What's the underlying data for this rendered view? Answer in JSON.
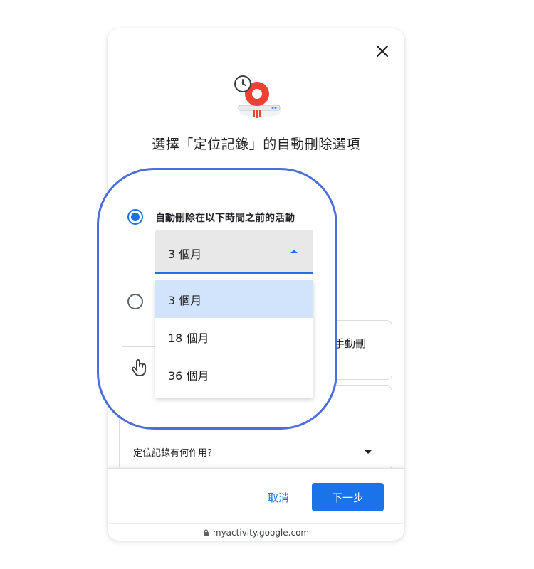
{
  "dialog": {
    "title": "選擇「定位記錄」的自動刪除選項",
    "close_icon": "close-icon",
    "illustration_icon": "location-history-clock-icon"
  },
  "options": {
    "auto_delete_label": "自動刪除在以下時間之前的活動",
    "selected_value": "3 個月",
    "menu_items": [
      "3 個月",
      "18 個月",
      "36 個月"
    ],
    "behind_text": "手動刪",
    "faq_label": "定位記錄有何作用？"
  },
  "footer": {
    "cancel_label": "取消",
    "next_label": "下一步"
  },
  "url_bar": {
    "url": "myactivity.google.com"
  },
  "colors": {
    "accent": "#1a73e8",
    "lens_border": "#4a6ee0",
    "menu_highlight": "#d2e3fc",
    "select_bg": "#e8e8e8"
  }
}
